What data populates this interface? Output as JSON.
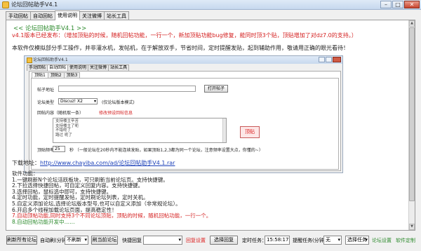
{
  "window": {
    "title": "论坛回帖助手V4.1",
    "min": "–",
    "max": "□",
    "close": "✕"
  },
  "tabs": [
    "手动回帖",
    "自动回帖",
    "使用说明",
    "关注微博",
    "站长工具"
  ],
  "active_tab": 2,
  "intro": {
    "heading": "<< 论坛回帖助手V4.1 >>",
    "version_note": "v4.1版本已经发布：（增加顶贴的时候，随机回帖功能，一行一个，新加顶贴功能bug修复，能同时顶3个贴，顶贴增加了对dz7.0的支持。）",
    "description": "本软件仅模拟部分手工操作，并非灌水机，发帖机，在于解放双手，节省时间，定时提醒发贴，起到辅助作用，敬请用正确的眼光看待！"
  },
  "screenshot": {
    "title": "论坛回帖助手V4.1",
    "tabs": [
      "手动回帖",
      "自动回帖",
      "使用说明",
      "关注微博",
      "站长工具"
    ],
    "subtabs": [
      "顶贴1",
      "顶贴2",
      "顶贴3"
    ],
    "post_url_label": "帖子地址",
    "open_post_button": "打开帖子",
    "forum_type_label": "论坛类型",
    "forum_type_value": "Discuz! X2",
    "forum_type_note": "(仅论坛版本模式)",
    "reply_content_label": "回帖内容（随机取一条）",
    "edit_reply_link": "修改预设回帖信息",
    "reply_lines": [
      "支持楼主辛苦",
      "支持楼主了呃",
      "不错呃了",
      "路过 呃了"
    ],
    "bump_button": "顶贴",
    "freq_label": "顶贴频率",
    "freq_value": "25",
    "freq_note": "秒 （一般论坛在20秒内不能连续发贴，如果顶贴1,2,3都为同一个论坛，注意频率设置大点，你懂的~）"
  },
  "download": {
    "label": "下载地址：",
    "url": "http://www.chayiba.com/ad/论坛回帖助手V4.1.rar"
  },
  "features": {
    "title": "软件功能：",
    "items": [
      "1.一键刷新N个论坛活跃板块，可只刷新当前论坛页。支持快捷键。",
      "2.下拉选择快捷回帖，可自定义回复内容。支持快捷键。",
      "3.选择回帖，鼠标选中即可，支持快捷键。",
      "4.定时功能，定时提醒发帖，定时刷论坛列表，定时关机。",
      "5.自定义添加论坛,选择论坛版本型号,也可以自定义添加（非常规论坛）。",
      "6.开启多个线程加载论坛页面，提高稳定性！",
      "7.自动顶帖功能,同时支持3个不同论坛顶贴，顶贴的时候，随机回帖功能，一行一个。",
      "8.自动回帖功能开发中……"
    ]
  },
  "bottom": {
    "refresh_button": "刷新所有论坛",
    "auto_refresh_label": "自动刷(分钟)",
    "auto_refresh_value": "不刷新",
    "refresh_current_button": "刷当前论坛",
    "quick_reply_label": "快捷回复",
    "reply_settings_link": "回复设置",
    "select_reply_button": "选择回复",
    "timer_label": "定时任务：",
    "timer_value": "15:58:17",
    "remind_label": "提醒任务(分钟)",
    "remind_value": "无",
    "select_task_value": "选择任务",
    "forum_settings_link": "论坛设置",
    "custom_link": "软件定制"
  },
  "colors": {
    "red": "#d42020",
    "green": "#2e8b2e",
    "link": "#1a3fb8"
  }
}
